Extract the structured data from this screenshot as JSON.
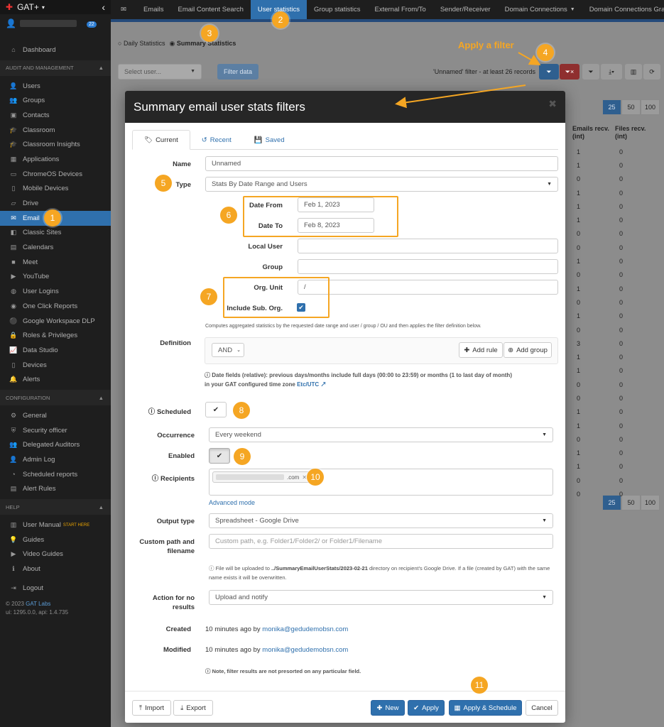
{
  "sidebar": {
    "app_title": "GAT+",
    "user_badge": "22",
    "dashboard": "Dashboard",
    "section_audit": "AUDIT AND MANAGEMENT",
    "audit_items": [
      {
        "label": "Users",
        "icon": "users-icon",
        "glyph": "👤"
      },
      {
        "label": "Groups",
        "icon": "groups-icon",
        "glyph": "👥"
      },
      {
        "label": "Contacts",
        "icon": "contacts-icon",
        "glyph": "▣"
      },
      {
        "label": "Classroom",
        "icon": "classroom-icon",
        "glyph": "🎓"
      },
      {
        "label": "Classroom Insights",
        "icon": "classroom-insights-icon",
        "glyph": "🎓"
      },
      {
        "label": "Applications",
        "icon": "applications-icon",
        "glyph": "▦"
      },
      {
        "label": "ChromeOS Devices",
        "icon": "chromeos-devices-icon",
        "glyph": "▭"
      },
      {
        "label": "Mobile Devices",
        "icon": "mobile-devices-icon",
        "glyph": "▯"
      },
      {
        "label": "Drive",
        "icon": "drive-icon",
        "glyph": "▱"
      },
      {
        "label": "Email",
        "icon": "email-icon",
        "glyph": "✉",
        "active": true
      },
      {
        "label": "Classic Sites",
        "icon": "classic-sites-icon",
        "glyph": "◧"
      },
      {
        "label": "Calendars",
        "icon": "calendars-icon",
        "glyph": "▤"
      },
      {
        "label": "Meet",
        "icon": "meet-icon",
        "glyph": "■"
      },
      {
        "label": "YouTube",
        "icon": "youtube-icon",
        "glyph": "▶"
      },
      {
        "label": "User Logins",
        "icon": "user-logins-icon",
        "glyph": "◍"
      },
      {
        "label": "One Click Reports",
        "icon": "one-click-reports-icon",
        "glyph": "◉"
      },
      {
        "label": "Google Workspace DLP",
        "icon": "dlp-icon",
        "glyph": "⚫"
      },
      {
        "label": "Roles & Privileges",
        "icon": "roles-icon",
        "glyph": "🔒"
      },
      {
        "label": "Data Studio",
        "icon": "data-studio-icon",
        "glyph": "📈"
      },
      {
        "label": "Devices",
        "icon": "devices-icon",
        "glyph": "▯"
      },
      {
        "label": "Alerts",
        "icon": "alerts-icon",
        "glyph": "🔔"
      }
    ],
    "section_config": "CONFIGURATION",
    "config_items": [
      {
        "label": "General",
        "icon": "general-icon",
        "glyph": "⚙"
      },
      {
        "label": "Security officer",
        "icon": "security-officer-icon",
        "glyph": "⛨"
      },
      {
        "label": "Delegated Auditors",
        "icon": "delegated-auditors-icon",
        "glyph": "👥"
      },
      {
        "label": "Admin Log",
        "icon": "admin-log-icon",
        "glyph": "👤"
      },
      {
        "label": "Scheduled reports",
        "icon": "scheduled-reports-icon",
        "glyph": "◔"
      },
      {
        "label": "Alert Rules",
        "icon": "alert-rules-icon",
        "glyph": "▤"
      }
    ],
    "section_help": "HELP",
    "help_items": [
      {
        "label": "User Manual",
        "icon": "user-manual-icon",
        "glyph": "▥",
        "sup": "START HERE"
      },
      {
        "label": "Guides",
        "icon": "guides-icon",
        "glyph": "💡"
      },
      {
        "label": "Video Guides",
        "icon": "video-guides-icon",
        "glyph": "▶"
      },
      {
        "label": "About",
        "icon": "about-icon",
        "glyph": "ℹ"
      }
    ],
    "logout": "Logout",
    "copyright_prefix": "© 2023",
    "copyright_link": "GAT Labs",
    "version": "ui: 1295.0.0, api: 1.4.735"
  },
  "topnav": {
    "tabs": [
      {
        "label": "Emails"
      },
      {
        "label": "Email Content Search"
      },
      {
        "label": "User statistics",
        "active": true
      },
      {
        "label": "Group statistics"
      },
      {
        "label": "External From/To"
      },
      {
        "label": "Sender/Receiver"
      },
      {
        "label": "Domain Connections",
        "caret": true
      },
      {
        "label": "Domain Connections Graph"
      }
    ]
  },
  "page": {
    "radio_daily": "Daily Statistics",
    "radio_summary": "Summary Statistics",
    "select_user_placeholder": "Select user...",
    "filter_data_button": "Filter data",
    "filter_status": "'Unnamed' filter -  at least 26 records",
    "pager": [
      "25",
      "50",
      "100"
    ],
    "col_emails_recv": "Emails recv. (int)",
    "col_files_recv": "Files recv. (int)",
    "rows": [
      [
        "1",
        "0"
      ],
      [
        "1",
        "0"
      ],
      [
        "0",
        "0"
      ],
      [
        "1",
        "0"
      ],
      [
        "1",
        "0"
      ],
      [
        "1",
        "0"
      ],
      [
        "0",
        "0"
      ],
      [
        "0",
        "0"
      ],
      [
        "1",
        "0"
      ],
      [
        "0",
        "0"
      ],
      [
        "1",
        "0"
      ],
      [
        "0",
        "0"
      ],
      [
        "1",
        "0"
      ],
      [
        "0",
        "0"
      ],
      [
        "3",
        "0"
      ],
      [
        "1",
        "0"
      ],
      [
        "1",
        "0"
      ],
      [
        "0",
        "0"
      ],
      [
        "0",
        "0"
      ],
      [
        "1",
        "0"
      ],
      [
        "1",
        "0"
      ],
      [
        "0",
        "0"
      ],
      [
        "1",
        "0"
      ],
      [
        "1",
        "0"
      ],
      [
        "0",
        "0"
      ],
      [
        "0",
        "0"
      ]
    ]
  },
  "annotations": {
    "n1": "1",
    "n2": "2",
    "n3": "3",
    "n4": "4",
    "n5": "5",
    "n6": "6",
    "n7": "7",
    "n8": "8",
    "n9": "9",
    "n10": "10",
    "n11": "11",
    "apply_filter": "Apply a filter"
  },
  "modal": {
    "title": "Summary email user stats filters",
    "tabs": {
      "current": "Current",
      "recent": "Recent",
      "saved": "Saved"
    },
    "name_label": "Name",
    "name_value": "Unnamed",
    "type_label": "Type",
    "type_value": "Stats By Date Range and Users",
    "date_from_label": "Date From",
    "date_from_value": "Feb 1, 2023",
    "date_to_label": "Date To",
    "date_to_value": "Feb 8, 2023",
    "local_user_label": "Local User",
    "group_label": "Group",
    "org_unit_label": "Org. Unit",
    "org_unit_value": "/",
    "include_sub_label": "Include Sub. Org.",
    "computes_help": "Computes aggregated statistics by the requested date range and user / group / OU and then applies the filter definition below.",
    "definition_label": "Definition",
    "and_value": "AND",
    "add_rule": "Add rule",
    "add_group": "Add group",
    "date_fields_note": "Date fields (relative): previous days/months include full days (00:00 to 23:59) or months (1 to last day of month) in your GAT configured time zone",
    "tz_link": "Etc/UTC",
    "scheduled_label": "Scheduled",
    "occurrence_label": "Occurrence",
    "occurrence_value": "Every weekend",
    "enabled_label": "Enabled",
    "recipients_label": "Recipients",
    "recipient_suffix": ".com",
    "advanced_mode": "Advanced mode",
    "output_type_label": "Output type",
    "output_type_value": "Spreadsheet - Google Drive",
    "custom_path_label": "Custom path and filename",
    "custom_path_placeholder": "Custom path, e.g. Folder1/Folder2/ or Folder1/Filename",
    "file_note_pre": "File will be uploaded to",
    "file_note_path": "../SummaryEmailUserStats/2023-02-21",
    "file_note_post": "directory on recipient's Google Drive. If a file (created by GAT) with the same name exists it will be overwritten.",
    "action_label": "Action for no results",
    "action_value": "Upload and notify",
    "created_label": "Created",
    "created_value": "10 minutes ago by",
    "created_by": "monika@gedudemobsn.com",
    "modified_label": "Modified",
    "modified_value": "10 minutes ago by",
    "modified_by": "monika@gedudemobsn.com",
    "note": "Note, filter results are not presorted on any particular field.",
    "footer": {
      "import": "Import",
      "export": "Export",
      "new": "New",
      "apply": "Apply",
      "apply_schedule": "Apply & Schedule",
      "cancel": "Cancel"
    }
  },
  "colors": {
    "accent": "#2f70ad",
    "annotation": "#f5a623",
    "sidebar_bg": "#1e1e1e"
  }
}
